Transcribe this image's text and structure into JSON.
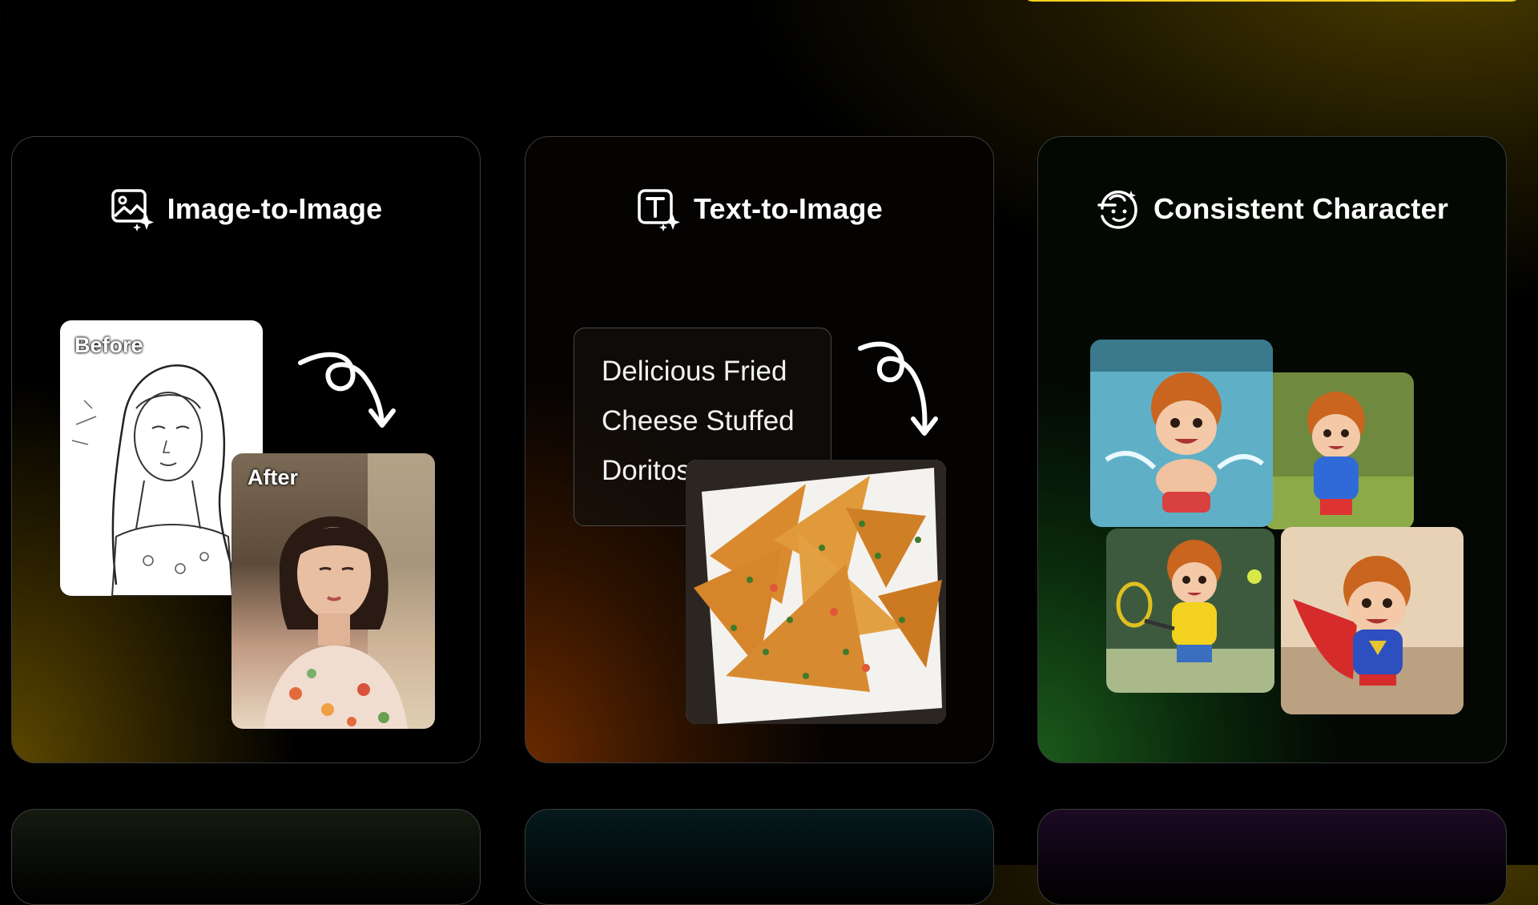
{
  "cards": {
    "i2i": {
      "title": "Image-to-Image",
      "before_label": "Before",
      "after_label": "After"
    },
    "t2i": {
      "title": "Text-to-Image",
      "prompt_lines": [
        "Delicious Fried",
        "Cheese Stuffed",
        "Doritos"
      ]
    },
    "cc": {
      "title": "Consistent Character"
    }
  },
  "icons": [
    "image-sparkle-icon",
    "text-sparkle-icon",
    "character-face-icon",
    "curly-arrow-icon"
  ],
  "colors": {
    "accent_yellow": "#f6d020",
    "card_border": "#3b3b3b"
  }
}
